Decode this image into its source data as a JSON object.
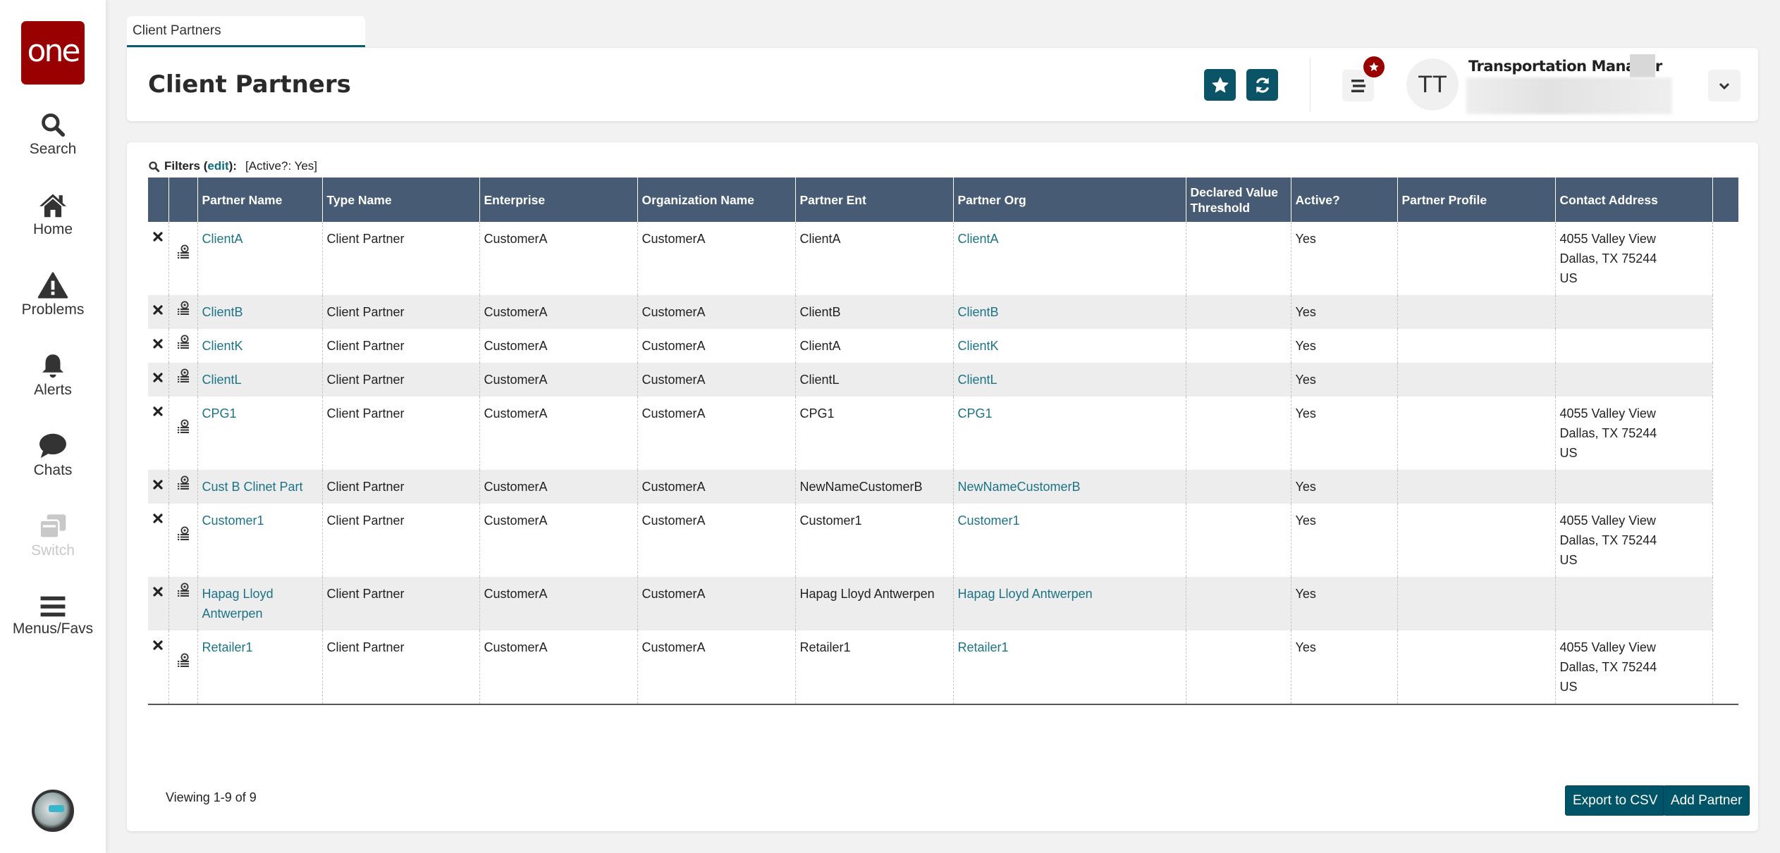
{
  "app": {
    "logo_text": "one",
    "tab_label": "Client Partners"
  },
  "sidebar": {
    "items": [
      {
        "label": "Search",
        "icon": "search-icon"
      },
      {
        "label": "Home",
        "icon": "home-icon"
      },
      {
        "label": "Problems",
        "icon": "warning-icon"
      },
      {
        "label": "Alerts",
        "icon": "bell-icon"
      },
      {
        "label": "Chats",
        "icon": "chat-bubble-icon"
      },
      {
        "label": "Switch",
        "icon": "switch-windows-icon",
        "disabled": true
      },
      {
        "label": "Menus/Favs",
        "icon": "hamburger-icon"
      }
    ]
  },
  "header": {
    "title": "Client Partners",
    "user_initials": "TT",
    "user_role": "Transportation Manager",
    "accent_color": "#0b5468",
    "badge_color": "#990000"
  },
  "filters": {
    "label": "Filters (",
    "edit_label": "edit",
    "label_suffix": "):",
    "value": "[Active?: Yes]"
  },
  "table": {
    "columns": [
      "",
      "",
      "Partner Name",
      "Type Name",
      "Enterprise",
      "Organization Name",
      "Partner Ent",
      "Partner Org",
      "Declared Value Threshold",
      "Active?",
      "Partner Profile",
      "Contact Address"
    ],
    "rows": [
      {
        "partner_name": "ClientA",
        "type_name": "Client Partner",
        "enterprise": "CustomerA",
        "organization_name": "CustomerA",
        "partner_ent": "ClientA",
        "partner_org": "ClientA",
        "declared_value_threshold": "",
        "active": "Yes",
        "partner_profile": "",
        "address": [
          "4055 Valley View",
          "Dallas, TX 75244",
          "US"
        ]
      },
      {
        "partner_name": "ClientB",
        "type_name": "Client Partner",
        "enterprise": "CustomerA",
        "organization_name": "CustomerA",
        "partner_ent": "ClientB",
        "partner_org": "ClientB",
        "declared_value_threshold": "",
        "active": "Yes",
        "partner_profile": "",
        "address": []
      },
      {
        "partner_name": "ClientK",
        "type_name": "Client Partner",
        "enterprise": "CustomerA",
        "organization_name": "CustomerA",
        "partner_ent": "ClientA",
        "partner_org": "ClientK",
        "declared_value_threshold": "",
        "active": "Yes",
        "partner_profile": "",
        "address": []
      },
      {
        "partner_name": "ClientL",
        "type_name": "Client Partner",
        "enterprise": "CustomerA",
        "organization_name": "CustomerA",
        "partner_ent": "ClientL",
        "partner_org": "ClientL",
        "declared_value_threshold": "",
        "active": "Yes",
        "partner_profile": "",
        "address": []
      },
      {
        "partner_name": "CPG1",
        "type_name": "Client Partner",
        "enterprise": "CustomerA",
        "organization_name": "CustomerA",
        "partner_ent": "CPG1",
        "partner_org": "CPG1",
        "declared_value_threshold": "",
        "active": "Yes",
        "partner_profile": "",
        "address": [
          "4055 Valley View",
          "Dallas, TX 75244",
          "US"
        ]
      },
      {
        "partner_name": "Cust B Clinet Part",
        "type_name": "Client Partner",
        "enterprise": "CustomerA",
        "organization_name": "CustomerA",
        "partner_ent": "NewNameCustomerB",
        "partner_org": "NewNameCustomerB",
        "declared_value_threshold": "",
        "active": "Yes",
        "partner_profile": "",
        "address": []
      },
      {
        "partner_name": "Customer1",
        "type_name": "Client Partner",
        "enterprise": "CustomerA",
        "organization_name": "CustomerA",
        "partner_ent": "Customer1",
        "partner_org": "Customer1",
        "declared_value_threshold": "",
        "active": "Yes",
        "partner_profile": "",
        "address": [
          "4055 Valley View",
          "Dallas, TX 75244",
          "US"
        ]
      },
      {
        "partner_name": "Hapag Lloyd Antwerpen",
        "type_name": "Client Partner",
        "enterprise": "CustomerA",
        "organization_name": "CustomerA",
        "partner_ent": "Hapag Lloyd Antwerpen",
        "partner_org": "Hapag Lloyd Antwerpen",
        "declared_value_threshold": "",
        "active": "Yes",
        "partner_profile": "",
        "address": []
      },
      {
        "partner_name": "Retailer1",
        "type_name": "Client Partner",
        "enterprise": "CustomerA",
        "organization_name": "CustomerA",
        "partner_ent": "Retailer1",
        "partner_org": "Retailer1",
        "declared_value_threshold": "",
        "active": "Yes",
        "partner_profile": "",
        "address": [
          "4055 Valley View",
          "Dallas, TX 75244",
          "US"
        ]
      }
    ]
  },
  "footer": {
    "viewing": "Viewing 1-9 of 9",
    "export_label": "Export to CSV",
    "add_label": "Add Partner"
  }
}
